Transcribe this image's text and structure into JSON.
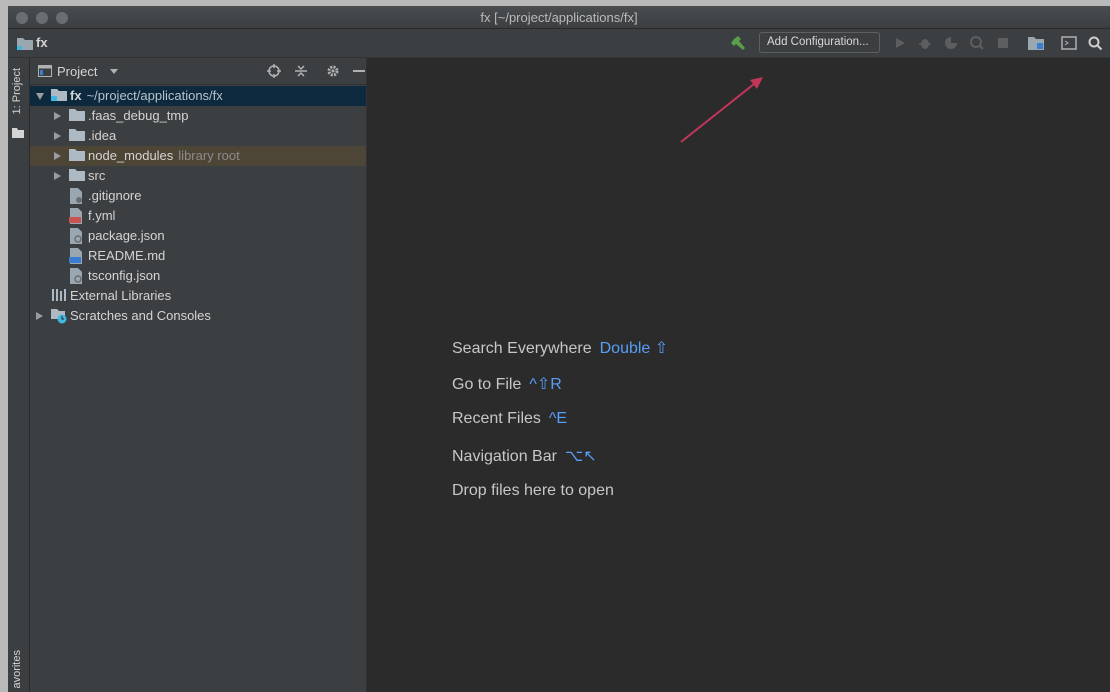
{
  "window": {
    "title": "fx [~/project/applications/fx]"
  },
  "navbar": {
    "project_name": "fx",
    "add_configuration_label": "Add Configuration..."
  },
  "left_stripe": {
    "project_tab": "1: Project",
    "favorites_tab": "avorites"
  },
  "project_panel": {
    "title": "Project",
    "tree": [
      {
        "label": "fx",
        "extra": "~/project/applications/fx",
        "icon": "module-folder-icon",
        "depth": 0,
        "expander": "expanded",
        "selected": true
      },
      {
        "label": ".faas_debug_tmp",
        "icon": "folder-icon",
        "depth": 1,
        "expander": "collapsed"
      },
      {
        "label": ".idea",
        "icon": "folder-icon",
        "depth": 1,
        "expander": "collapsed"
      },
      {
        "label": "node_modules",
        "extra": "library root",
        "icon": "folder-icon",
        "depth": 1,
        "expander": "collapsed",
        "library": true
      },
      {
        "label": "src",
        "icon": "folder-icon",
        "depth": 1,
        "expander": "collapsed"
      },
      {
        "label": ".gitignore",
        "icon": "gitignore-file-icon",
        "depth": 1,
        "expander": "none"
      },
      {
        "label": "f.yml",
        "icon": "yaml-file-icon",
        "depth": 1,
        "expander": "none"
      },
      {
        "label": "package.json",
        "icon": "json-file-icon",
        "depth": 1,
        "expander": "none"
      },
      {
        "label": "README.md",
        "icon": "markdown-file-icon",
        "depth": 1,
        "expander": "none"
      },
      {
        "label": "tsconfig.json",
        "icon": "json-file-icon",
        "depth": 1,
        "expander": "none"
      },
      {
        "label": "External Libraries",
        "icon": "libraries-icon",
        "depth": 0,
        "expander": "none"
      },
      {
        "label": "Scratches and Consoles",
        "icon": "scratches-icon",
        "depth": 0,
        "expander": "collapsed"
      }
    ]
  },
  "editor": {
    "hints": [
      {
        "label": "Search Everywhere",
        "shortcut": "Double ⇧"
      },
      {
        "label": "Go to File",
        "shortcut": "^⇧R"
      },
      {
        "label": "Recent Files",
        "shortcut": "^E"
      },
      {
        "label": "Navigation Bar",
        "shortcut": "⌥↖"
      },
      {
        "label": "Drop files here to open",
        "shortcut": ""
      }
    ]
  },
  "colors": {
    "selection": "#0d293e",
    "library_row": "#4d4536",
    "shortcut_blue": "#589df6",
    "annotation_arrow": "#c2365a",
    "build_hammer": "#5a9e4b"
  }
}
